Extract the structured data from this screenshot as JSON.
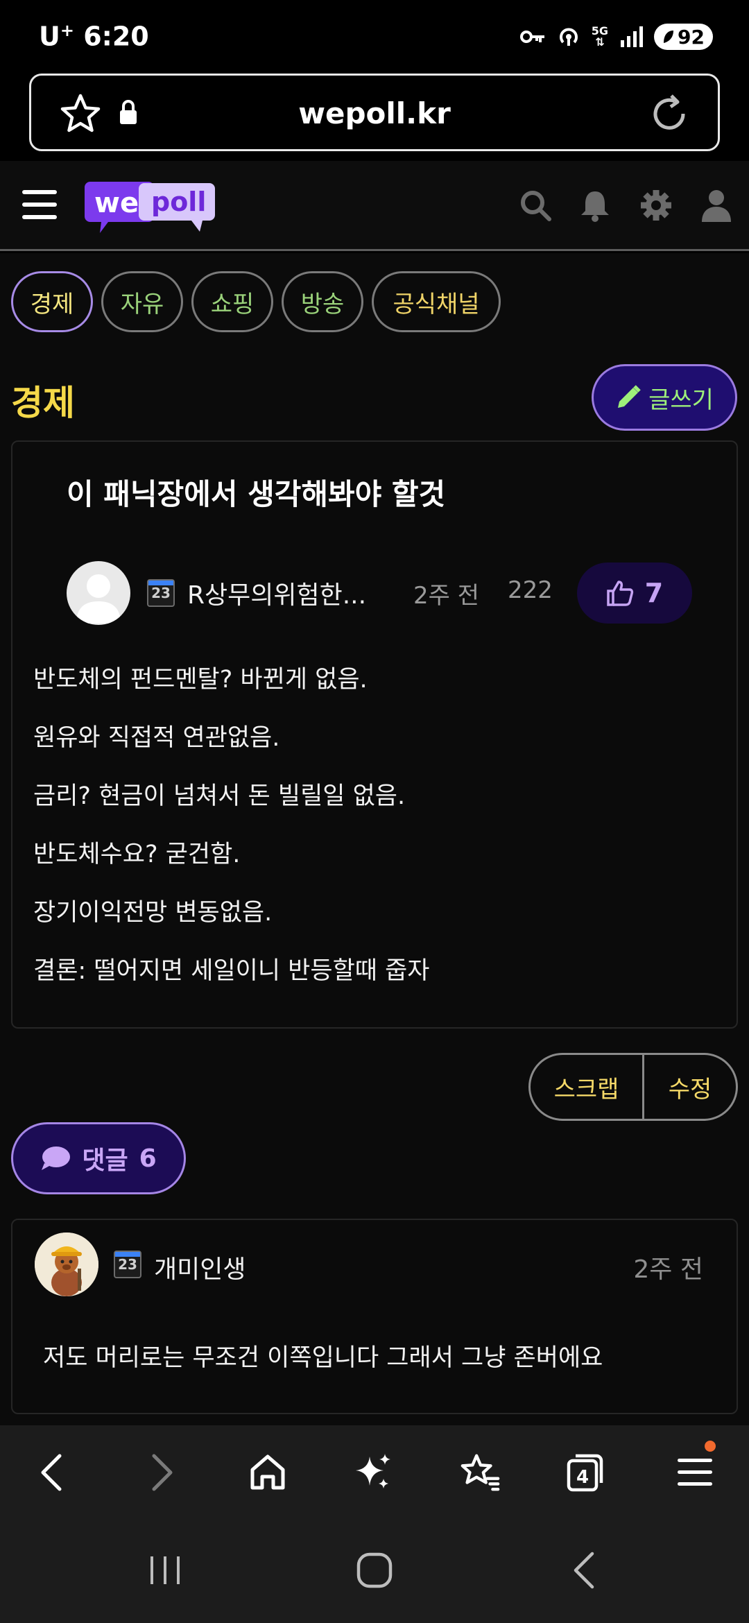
{
  "status_bar": {
    "carrier": "U",
    "carrier_mark": "+",
    "time": "6:20",
    "network": "5G",
    "battery": "92",
    "icons": [
      "key-icon",
      "hotspot-icon",
      "5g-icon",
      "signal-icon",
      "battery-icon"
    ]
  },
  "browser": {
    "url": "wepoll.kr",
    "icons": [
      "bookmark-star-icon",
      "lock-icon",
      "reload-icon"
    ]
  },
  "site_header": {
    "logo_we": "we",
    "logo_poll": "poll",
    "icons": [
      "menu-icon",
      "search-icon",
      "bell-icon",
      "gear-icon",
      "user-icon"
    ]
  },
  "tabs": [
    {
      "label": "경제",
      "active": true
    },
    {
      "label": "자유",
      "active": false
    },
    {
      "label": "쇼핑",
      "active": false
    },
    {
      "label": "방송",
      "active": false
    },
    {
      "label": "공식채널",
      "active": false
    }
  ],
  "section": {
    "title": "경제",
    "write_label": "글쓰기"
  },
  "post": {
    "title": "이 패닉장에서 생각해봐야 할것",
    "author_badge": "23",
    "author": "R상무의위험한...",
    "time": "2주 전",
    "views": "222",
    "likes": "7",
    "body": [
      "반도체의 펀드멘탈? 바뀐게 없음.",
      "원유와 직접적 연관없음.",
      "금리? 현금이 넘쳐서 돈 빌릴일 없음.",
      "반도체수요? 굳건함.",
      "장기이익전망 변동없음.",
      "결론:  떨어지면 세일이니 반등할때 줍자"
    ]
  },
  "actions": {
    "scrap_label": "스크랩",
    "edit_label": "수정"
  },
  "comments": {
    "toggle_label": "댓글",
    "count": "6",
    "items": [
      {
        "badge": "23",
        "author": "개미인생",
        "time": "2주 전",
        "text": "저도 머리로는 무조건 이쪽입니다 그래서 그냥 존버에요"
      }
    ]
  },
  "browser_nav": {
    "tab_count": "4",
    "icons": [
      "back-icon",
      "forward-icon",
      "home-icon",
      "sparkle-icon",
      "bookmarks-icon",
      "tabs-icon",
      "menu-icon"
    ]
  },
  "system_nav": {
    "icons": [
      "recents-icon",
      "home-icon",
      "back-icon"
    ]
  },
  "colors": {
    "accent_purple": "#a78be6",
    "title_yellow": "#f5d949",
    "tab_green": "#9ad27a",
    "notification": "#f26a2e"
  }
}
